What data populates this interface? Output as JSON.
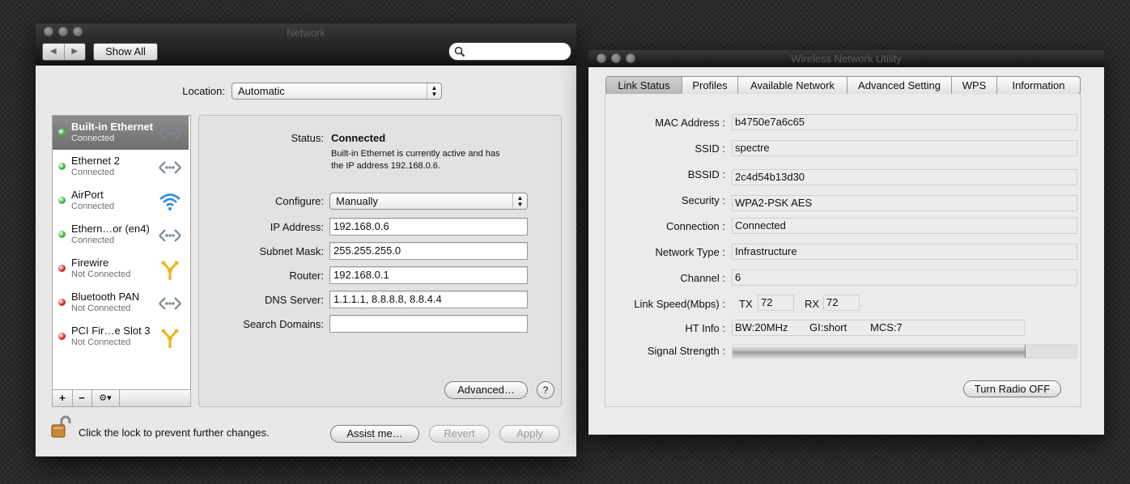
{
  "network": {
    "title": "Network",
    "show_all": "Show All",
    "search_placeholder": "",
    "location_label": "Location:",
    "location_value": "Automatic",
    "services": [
      {
        "name": "Built-in Ethernet",
        "status": "Connected",
        "icon": "ethernet-icon"
      },
      {
        "name": "Ethernet 2",
        "status": "Connected",
        "icon": "ethernet-icon"
      },
      {
        "name": "AirPort",
        "status": "Connected",
        "icon": "wifi-icon"
      },
      {
        "name": "Ethern…or (en4)",
        "status": "Connected",
        "icon": "ethernet-icon"
      },
      {
        "name": "Firewire",
        "status": "Not Connected",
        "icon": "firewire-icon"
      },
      {
        "name": "Bluetooth PAN",
        "status": "Not Connected",
        "icon": "ethernet-icon"
      },
      {
        "name": "PCI Fir…e Slot 3",
        "status": "Not Connected",
        "icon": "firewire-icon"
      }
    ],
    "status_label": "Status:",
    "status_value": "Connected",
    "status_desc_1": "Built-in Ethernet is currently active and has",
    "status_desc_2": "the IP address 192.168.0.6.",
    "configure_label": "Configure:",
    "configure_value": "Manually",
    "ip_label": "IP Address:",
    "ip_value": "192.168.0.6",
    "subnet_label": "Subnet Mask:",
    "subnet_value": "255.255.255.0",
    "router_label": "Router:",
    "router_value": "192.168.0.1",
    "dns_label": "DNS Server:",
    "dns_value": "1.1.1.1, 8.8.8.8, 8.8.4.4",
    "search_domains_label": "Search Domains:",
    "search_domains_value": "",
    "advanced": "Advanced…",
    "help": "?",
    "add": "+",
    "remove": "−",
    "gear": "⚙▾",
    "lock_text": "Click the lock to prevent further changes.",
    "assist": "Assist me…",
    "revert": "Revert",
    "apply": "Apply",
    "colors": {
      "green": "#3cb43c",
      "red": "#d42a2a"
    }
  },
  "wireless": {
    "title": "Wireless Network Utility",
    "tabs": [
      "Link Status",
      "Profiles",
      "Available Network",
      "Advanced Setting",
      "WPS",
      "Information"
    ],
    "mac_label": "MAC Address :",
    "mac_value": "b4750e7a6c65",
    "ssid_label": "SSID :",
    "ssid_value": "spectre",
    "bssid_label": "BSSID :",
    "bssid_value": "2c4d54b13d30",
    "security_label": "Security :",
    "security_value": "WPA2-PSK AES",
    "connection_label": "Connection :",
    "connection_value": "Connected",
    "nettype_label": "Network Type :",
    "nettype_value": "Infrastructure",
    "channel_label": "Channel :",
    "channel_value": "6",
    "linkspeed_label": "Link Speed(Mbps) :",
    "tx_label": "TX",
    "tx_value": "72",
    "rx_label": "RX",
    "rx_value": "72",
    "htinfo_label": "HT Info :",
    "ht_bw": "BW:20MHz",
    "ht_gi": "GI:short",
    "ht_mcs": "MCS:7",
    "signal_label": "Signal Strength :",
    "signal_level": 0.85,
    "radio_off": "Turn Radio OFF"
  }
}
